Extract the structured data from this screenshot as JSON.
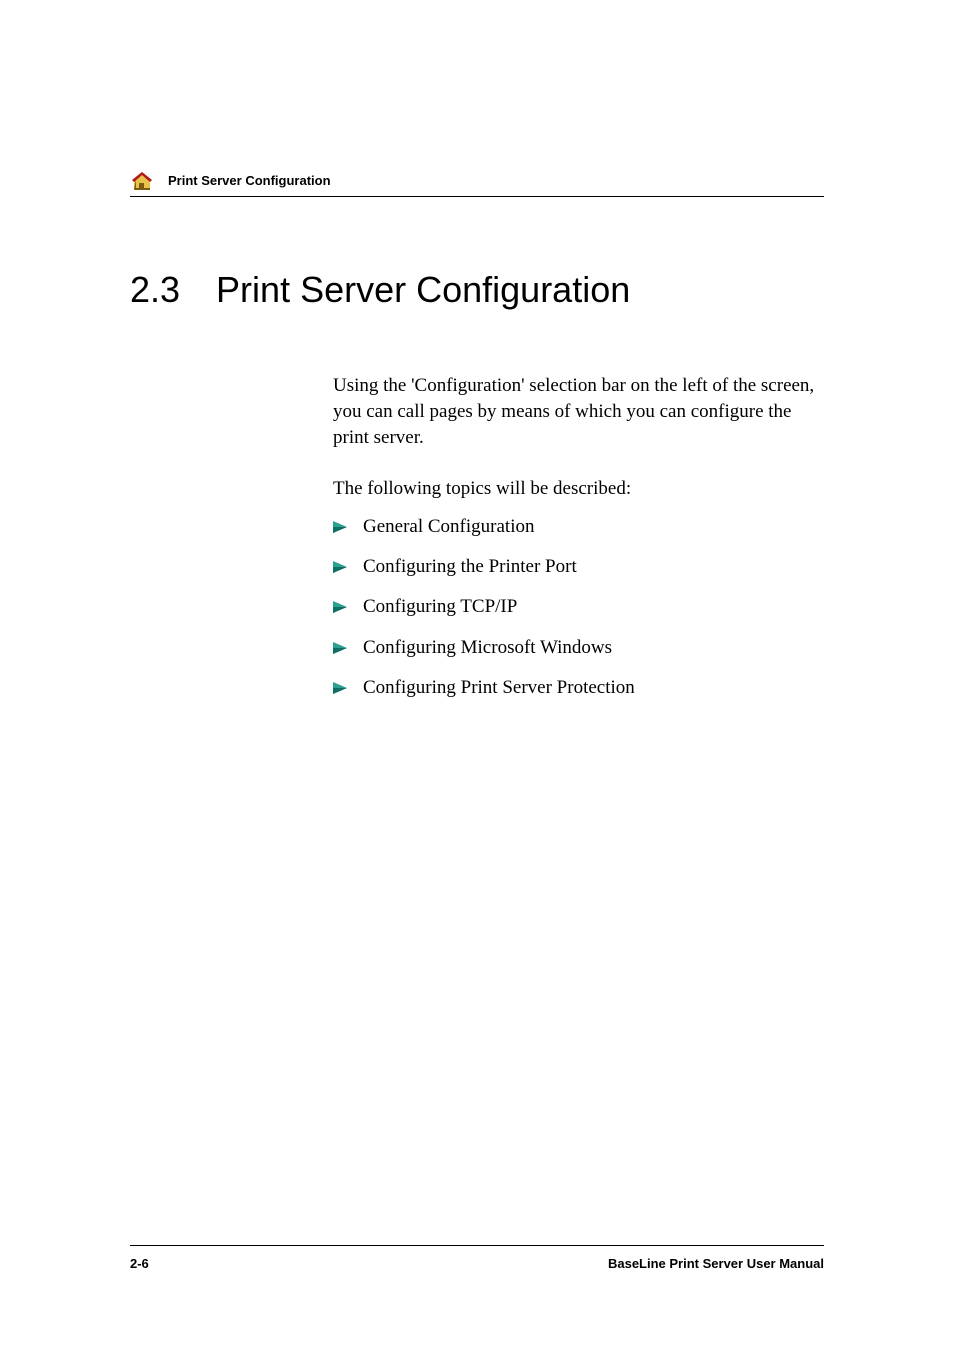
{
  "header": {
    "label": "Print Server Configuration"
  },
  "section": {
    "number": "2.3",
    "title": "Print Server Configuration"
  },
  "body": {
    "para1": "Using the 'Configuration' selection bar on the left of the screen, you can call pages by means of which you can configure the print server.",
    "para2": "The following topics will be described:",
    "items": [
      "General Configuration",
      "Configuring the Printer Port",
      "Configuring TCP/IP",
      "Configuring Microsoft Windows",
      "Configuring Print Server Protection"
    ]
  },
  "footer": {
    "page_number": "2-6",
    "manual_title": "BaseLine Print Server User Manual"
  },
  "colors": {
    "arrow_teal": "#2a9f92",
    "arrow_dark": "#116e65",
    "home_red": "#b01818",
    "home_yellow": "#e8c24a",
    "home_shadow": "#7c5a10"
  }
}
